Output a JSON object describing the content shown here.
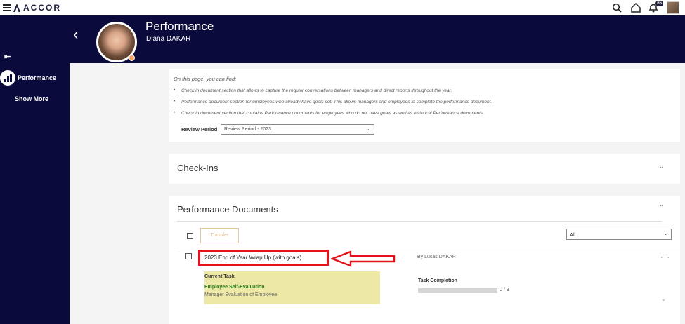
{
  "brand": {
    "name": "ACCOR"
  },
  "topbar": {
    "icons": [
      "search-icon",
      "home-icon",
      "notifications-icon"
    ],
    "notification_count": "65"
  },
  "sidebar": {
    "collapse_glyph": "⇤",
    "items": [
      {
        "label": "Performance",
        "icon": "performance-chart-icon",
        "active": true
      }
    ],
    "show_more_label": "Show More"
  },
  "header": {
    "title": "Performance",
    "subtitle": "Diana DAKAR",
    "back_glyph": "‹"
  },
  "info": {
    "intro": "On this page, you can find:",
    "bullets": [
      "Check in document section that allows to capture the regular conversations between managers and direct reports throughout the year.",
      "Performance document section for employees who already have goals set. This allows managers and employees to complete the performance document.",
      "Check in document section that contains Performance documents for employees who do not have goals as well as historical Performance documents."
    ],
    "review_period_label": "Review Period",
    "review_period_value": "Review Period - 2023"
  },
  "checkins": {
    "title": "Check-Ins",
    "state": "collapsed"
  },
  "performance_documents": {
    "title": "Performance Documents",
    "state": "expanded",
    "transfer_label": "Transfer",
    "filter_value": "All",
    "documents": [
      {
        "title": "2023 End of Year Wrap Up (with goals)",
        "author": "By Lucas DAKAR",
        "current_task_label": "Current Task",
        "current_task": "Employee Self-Evaluation",
        "next_task": "Manager Evaluation of Employee",
        "task_completion_label": "Task Completion",
        "task_completion_text": "0 / 3",
        "task_completion_fraction": 0
      }
    ]
  },
  "colors": {
    "navy": "#0a0a3c",
    "highlight_red": "#e3121b",
    "task_bg": "#ede8a6",
    "task_green": "#2a7a20"
  }
}
